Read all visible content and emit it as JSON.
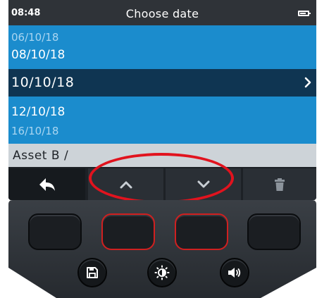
{
  "status_bar": {
    "time": "08:48",
    "title": "Choose date",
    "battery_icon": "battery-icon"
  },
  "date_list": {
    "items": [
      {
        "label": "06/10/18",
        "state": "faded"
      },
      {
        "label": "08/10/18",
        "state": "adjacent"
      },
      {
        "label": "10/10/18",
        "state": "selected"
      },
      {
        "label": "12/10/18",
        "state": "adjacent"
      },
      {
        "label": "16/10/18",
        "state": "faded"
      }
    ],
    "selected_indicator_icon": "chevron-right-icon"
  },
  "breadcrumb": {
    "text": "Asset B /"
  },
  "softkeys": [
    {
      "icon": "back-arrow-icon"
    },
    {
      "icon": "chevron-up-icon"
    },
    {
      "icon": "chevron-down-icon"
    },
    {
      "icon": "trash-icon"
    }
  ],
  "hardware": {
    "function_keys_highlighted": [
      2,
      3
    ],
    "round_buttons": [
      {
        "icon": "save-icon"
      },
      {
        "icon": "brightness-icon"
      },
      {
        "icon": "volume-icon"
      }
    ]
  },
  "colors": {
    "list_bg": "#1b8ccd",
    "selected_row_bg": "#0f3552",
    "status_bar_bg": "#2f3338",
    "breadcrumb_bg": "#cdd3d8",
    "highlight": "#e1131e"
  }
}
